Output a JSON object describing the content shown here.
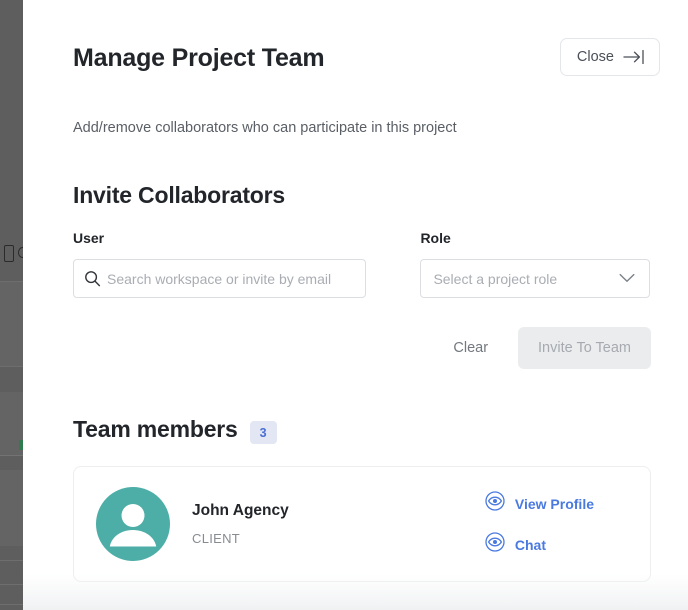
{
  "modal": {
    "title": "Manage Project Team",
    "subtitle": "Add/remove collaborators who can participate in this project",
    "close_button": {
      "label": "Close",
      "icon": "exit-arrow-icon"
    }
  },
  "invite_section": {
    "heading": "Invite Collaborators",
    "user_field": {
      "label": "User",
      "placeholder": "Search workspace or invite by email",
      "value": "",
      "icon": "search-icon"
    },
    "role_field": {
      "label": "Role",
      "selected": "Select a project role",
      "icon": "chevron-down-icon",
      "options": [
        "Select a project role"
      ]
    },
    "clear_button": "Clear",
    "invite_button": "Invite To Team"
  },
  "team_section": {
    "heading": "Team members",
    "count": "3",
    "members": [
      {
        "name": "John Agency",
        "role": "CLIENT",
        "avatar_icon": "user-avatar-icon",
        "actions": [
          {
            "label": "View Profile",
            "icon": "eye-icon"
          },
          {
            "label": "Chat",
            "icon": "eye-icon"
          }
        ]
      }
    ]
  },
  "colors": {
    "accent_blue": "#4a7ae0",
    "avatar_teal": "#4daea7",
    "badge_bg": "#e3e7f3",
    "backdrop": "#5e5e5e",
    "text_primary": "#22252a",
    "text_muted": "#878c93"
  }
}
